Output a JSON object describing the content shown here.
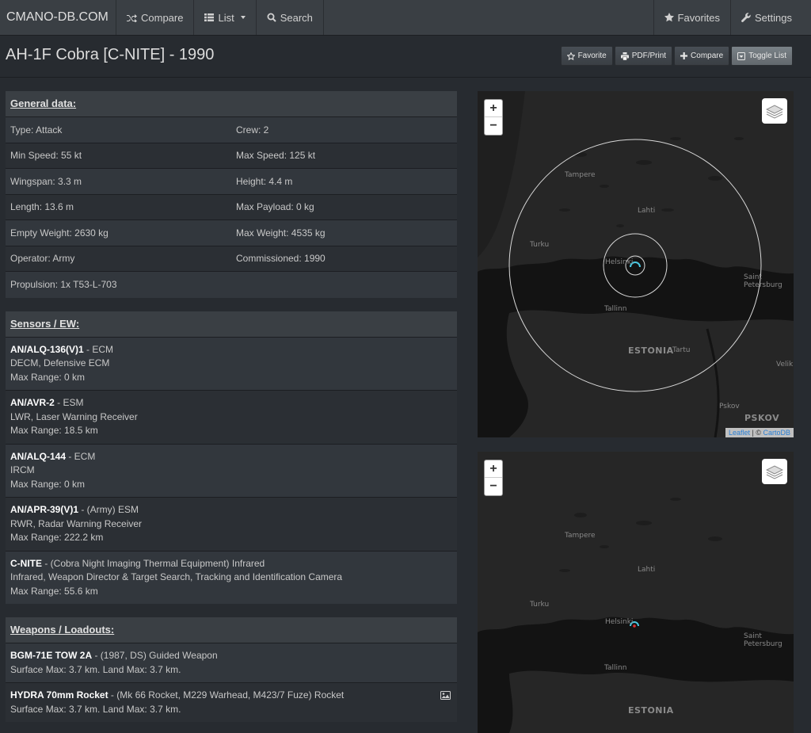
{
  "nav": {
    "brand": "CMANO-DB.COM",
    "compare": "Compare",
    "list": "List",
    "search": "Search",
    "favorites": "Favorites",
    "settings": "Settings"
  },
  "page": {
    "title": "AH-1F Cobra [C-NITE] - 1990",
    "actions": {
      "favorite": "Favorite",
      "pdf": "PDF/Print",
      "compare": "Compare",
      "toggle": "Toggle List"
    }
  },
  "general": {
    "heading": "General data:",
    "rows": [
      [
        "Type: Attack",
        "Crew: 2"
      ],
      [
        "Min Speed: 55 kt",
        "Max Speed: 125 kt"
      ],
      [
        "Wingspan: 3.3 m",
        "Height: 4.4 m"
      ],
      [
        "Length: 13.6 m",
        "Max Payload: 0 kg"
      ],
      [
        "Empty Weight: 2630 kg",
        "Max Weight: 4535 kg"
      ],
      [
        "Operator: Army",
        "Commissioned: 1990"
      ],
      [
        "Propulsion: 1x T53-L-703",
        ""
      ]
    ]
  },
  "sensors": {
    "heading": "Sensors / EW:",
    "items": [
      {
        "name": "AN/ALQ-136(V)1",
        "suffix": " - ECM",
        "desc": "DECM, Defensive ECM",
        "range": "Max Range: 0 km"
      },
      {
        "name": "AN/AVR-2",
        "suffix": " - ESM",
        "desc": "LWR, Laser Warning Receiver",
        "range": "Max Range: 18.5 km"
      },
      {
        "name": "AN/ALQ-144",
        "suffix": " - ECM",
        "desc": "IRCM",
        "range": "Max Range: 0 km"
      },
      {
        "name": "AN/APR-39(V)1",
        "suffix": " - (Army) ESM",
        "desc": "RWR, Radar Warning Receiver",
        "range": "Max Range: 222.2 km"
      },
      {
        "name": "C-NITE",
        "suffix": " - (Cobra Night Imaging Thermal Equipment) Infrared",
        "desc": "Infrared, Weapon Director & Target Search, Tracking and Identification Camera",
        "range": "Max Range: 55.6 km"
      }
    ]
  },
  "weapons": {
    "heading": "Weapons / Loadouts:",
    "items": [
      {
        "name": "BGM-71E TOW 2A",
        "suffix": " - (1987, DS) Guided Weapon",
        "range": "Surface Max: 3.7 km. Land Max: 3.7 km."
      },
      {
        "name": "HYDRA 70mm Rocket",
        "suffix": " - (Mk 66 Rocket, M229 Warhead, M423/7 Fuze) Rocket",
        "range": "Surface Max: 3.7 km. Land Max: 3.7 km."
      }
    ]
  },
  "map": {
    "zoom_in": "+",
    "zoom_out": "−",
    "attribution_leaflet": "Leaflet",
    "attribution_sep": " | © ",
    "attribution_carto": "CartoDB",
    "places": {
      "tampere": "Tampere",
      "lahti": "Lahti",
      "turku": "Turku",
      "helsinki": "Helsinki",
      "tallinn": "Tallinn",
      "estonia": "ESTONIA",
      "tartu": "Tartu",
      "pskov_small": "Pskov",
      "pskov": "PSKOV",
      "stpete": "Saint Petersburg",
      "velik": "Velik"
    }
  }
}
